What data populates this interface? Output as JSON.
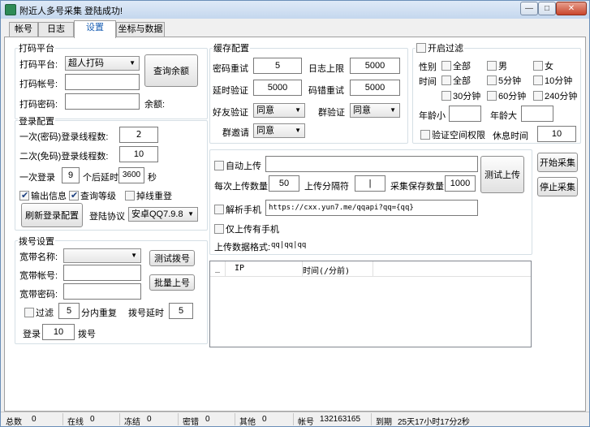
{
  "window": {
    "title": "附近人多号采集 登陆成功!",
    "min_label": "—",
    "max_label": "□",
    "close_label": "✕"
  },
  "tabs": [
    {
      "label": "帐号"
    },
    {
      "label": "日志"
    },
    {
      "label": "设置",
      "active": true
    },
    {
      "label": "坐标与数据"
    }
  ],
  "captcha_platform": {
    "group_title": "打码平台",
    "platform_label": "打码平台:",
    "platform_value": "超人打码",
    "account_label": "打码帐号:",
    "account_value": "",
    "password_label": "打码密码:",
    "password_value": "",
    "query_balance_button": "查询余额",
    "balance_label": "余额:"
  },
  "login_config": {
    "group_title": "登录配置",
    "first_threads_label": "一次(密码)登录线程数:",
    "first_threads_value": "2",
    "second_threads_label": "二次(免码)登录线程数:",
    "second_threads_value": "10",
    "delay_prefix": "一次登录",
    "delay_count": "9",
    "delay_mid": "个后延时",
    "delay_seconds": "3600",
    "delay_unit": "秒",
    "output_info_label": "输出信息",
    "output_info_checked": true,
    "query_level_label": "查询等级",
    "query_level_checked": true,
    "reconnect_label": "掉线重登",
    "reconnect_checked": false,
    "refresh_button": "刷新登录配置",
    "protocol_label": "登陆协议",
    "protocol_value": "安卓QQ7.9.8"
  },
  "dialup": {
    "group_title": "拨号设置",
    "broadband_name_label": "宽带名称:",
    "broadband_name_value": "",
    "broadband_account_label": "宽带帐号:",
    "broadband_account_value": "",
    "broadband_password_label": "宽带密码:",
    "broadband_password_value": "",
    "test_dial_button": "测试拨号",
    "batch_upload_button": "批量上号",
    "filter_label": "过滤",
    "filter_checked": false,
    "filter_minutes": "5",
    "filter_suffix": "分内重复",
    "dial_delay_label": "拨号延时",
    "dial_delay_value": "5",
    "login_prefix": "登录",
    "login_count": "10",
    "login_suffix": "拨号"
  },
  "cache_config": {
    "group_title": "缓存配置",
    "captcha_retry_label": "密码重试",
    "captcha_retry_value": "5",
    "daily_limit_label": "日志上限",
    "daily_limit_value": "5000",
    "delay_verify_label": "延时验证",
    "delay_verify_value": "5000",
    "code_retry_label": "码错重试",
    "code_retry_value": "5000",
    "friend_verify_label": "好友验证",
    "friend_verify_value": "同意",
    "group_verify_label": "群验证",
    "group_verify_value": "同意",
    "group_invite_label": "群邀请",
    "group_invite_value": "同意"
  },
  "filter": {
    "group_title": "开启过滤",
    "enabled": false,
    "gender_label": "性别",
    "gender_options": [
      {
        "label": "全部",
        "checked": false
      },
      {
        "label": "男",
        "checked": false
      },
      {
        "label": "女",
        "checked": false
      }
    ],
    "time_label": "时间",
    "time_options": [
      {
        "label": "全部",
        "checked": false
      },
      {
        "label": "5分钟",
        "checked": false
      },
      {
        "label": "10分钟",
        "checked": false
      },
      {
        "label": "30分钟",
        "checked": false
      },
      {
        "label": "60分钟",
        "checked": false
      },
      {
        "label": "240分钟",
        "checked": false
      }
    ],
    "age_min_label": "年龄小",
    "age_min_value": "",
    "age_max_label": "年龄大",
    "age_max_value": "",
    "space_perm_label": "验证空间权限",
    "space_perm_checked": false,
    "rest_time_label": "休息时间",
    "rest_time_value": "10"
  },
  "upload": {
    "auto_upload_label": "自动上传",
    "auto_upload_checked": false,
    "auto_upload_value": "",
    "per_upload_label": "每次上传数量",
    "per_upload_value": "50",
    "separator_label": "上传分隔符",
    "separator_value": "|",
    "save_count_label": "采集保存数量",
    "save_count_value": "1000",
    "test_upload_button": "测试上传",
    "parse_phone_label": "解析手机",
    "parse_phone_checked": false,
    "parse_phone_url": "https://cxx.yun7.me/qqapi?qq={qq}",
    "phone_only_label": "仅上传有手机",
    "phone_only_checked": false,
    "format_label": "上传数据格式:",
    "format_value": "qq|qq|qq"
  },
  "actions": {
    "start_button": "开始采集",
    "stop_button": "停止采集"
  },
  "listview": {
    "columns": [
      "_",
      "IP",
      "时间(/分前)"
    ]
  },
  "statusbar": {
    "total_label": "总数",
    "total_value": "0",
    "online_label": "在线",
    "online_value": "0",
    "frozen_label": "冻结",
    "frozen_value": "0",
    "pwd_error_label": "密错",
    "pwd_error_value": "0",
    "other_label": "其他",
    "other_value": "0",
    "account_label": "帐号",
    "account_value": "132163165",
    "expire_label": "到期",
    "expire_value": "25天17小时17分2秒"
  }
}
